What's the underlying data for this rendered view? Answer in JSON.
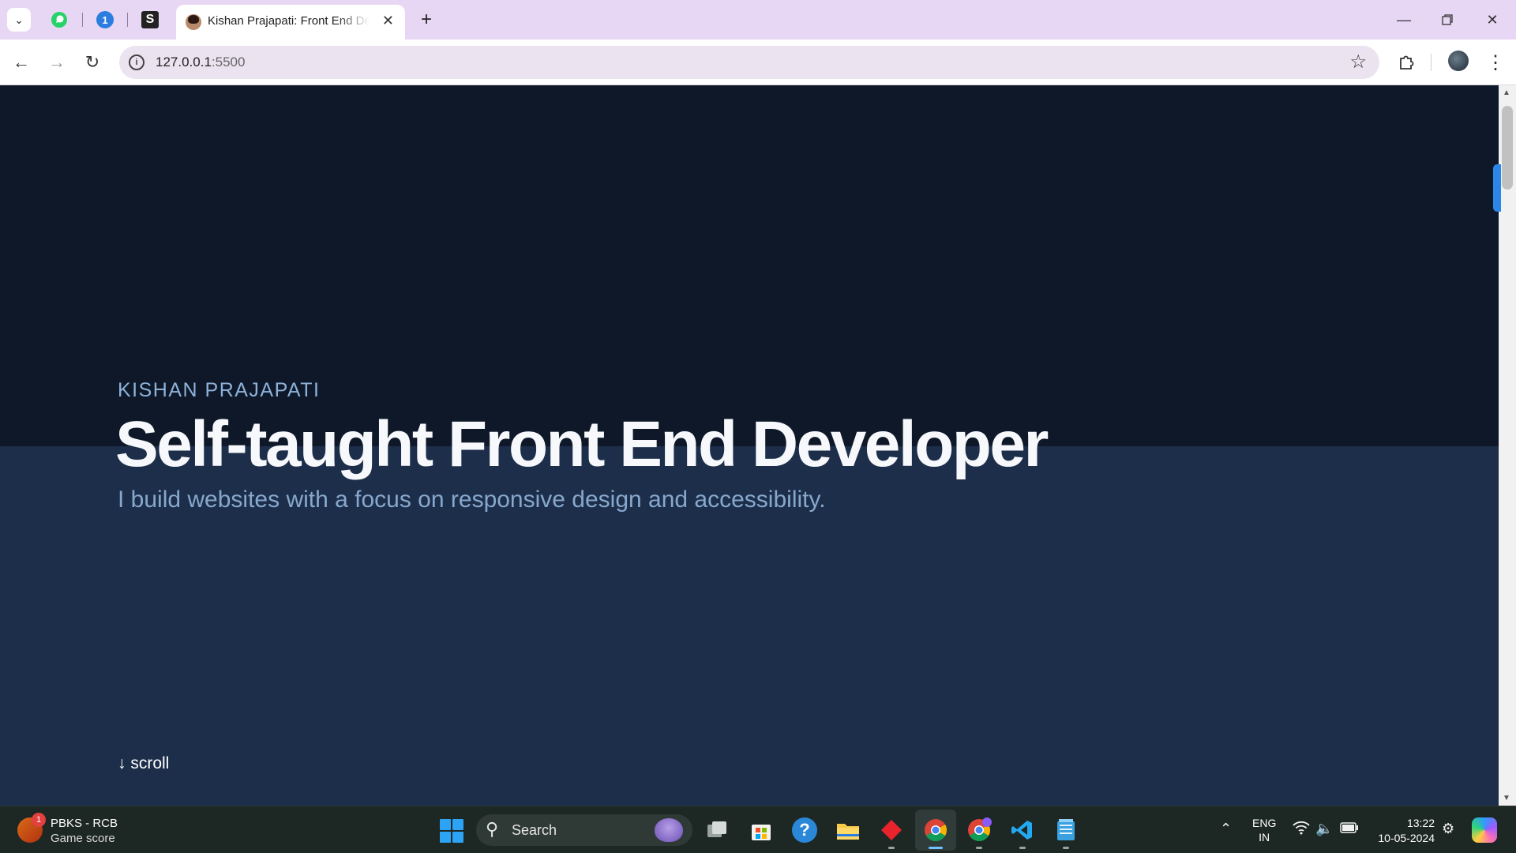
{
  "browser": {
    "tabs": {
      "active_title": "Kishan Prajapati: Front End Developer",
      "pinned_badge": "1",
      "pinned_letter": "S"
    },
    "address": {
      "host": "127.0.0.1",
      "port": ":5500"
    }
  },
  "page": {
    "eyebrow": "KISHAN PRAJAPATI",
    "headline": "Self-taught Front End Developer",
    "subline": "I build websites with a focus on responsive design and accessibility.",
    "scroll_label": "↓ scroll"
  },
  "taskbar": {
    "widget": {
      "title": "PBKS - RCB",
      "subtitle": "Game score",
      "badge": "1"
    },
    "search_label": "Search",
    "language": {
      "line1": "ENG",
      "line2": "IN"
    },
    "clock": {
      "time": "13:22",
      "date": "10-05-2024"
    }
  },
  "colors": {
    "page_top": "#0e1828",
    "page_bottom": "#1d2e4a",
    "eyebrow": "#8eb2da",
    "headline": "#f6f8fb",
    "tabstrip": "#e8d6f5"
  }
}
